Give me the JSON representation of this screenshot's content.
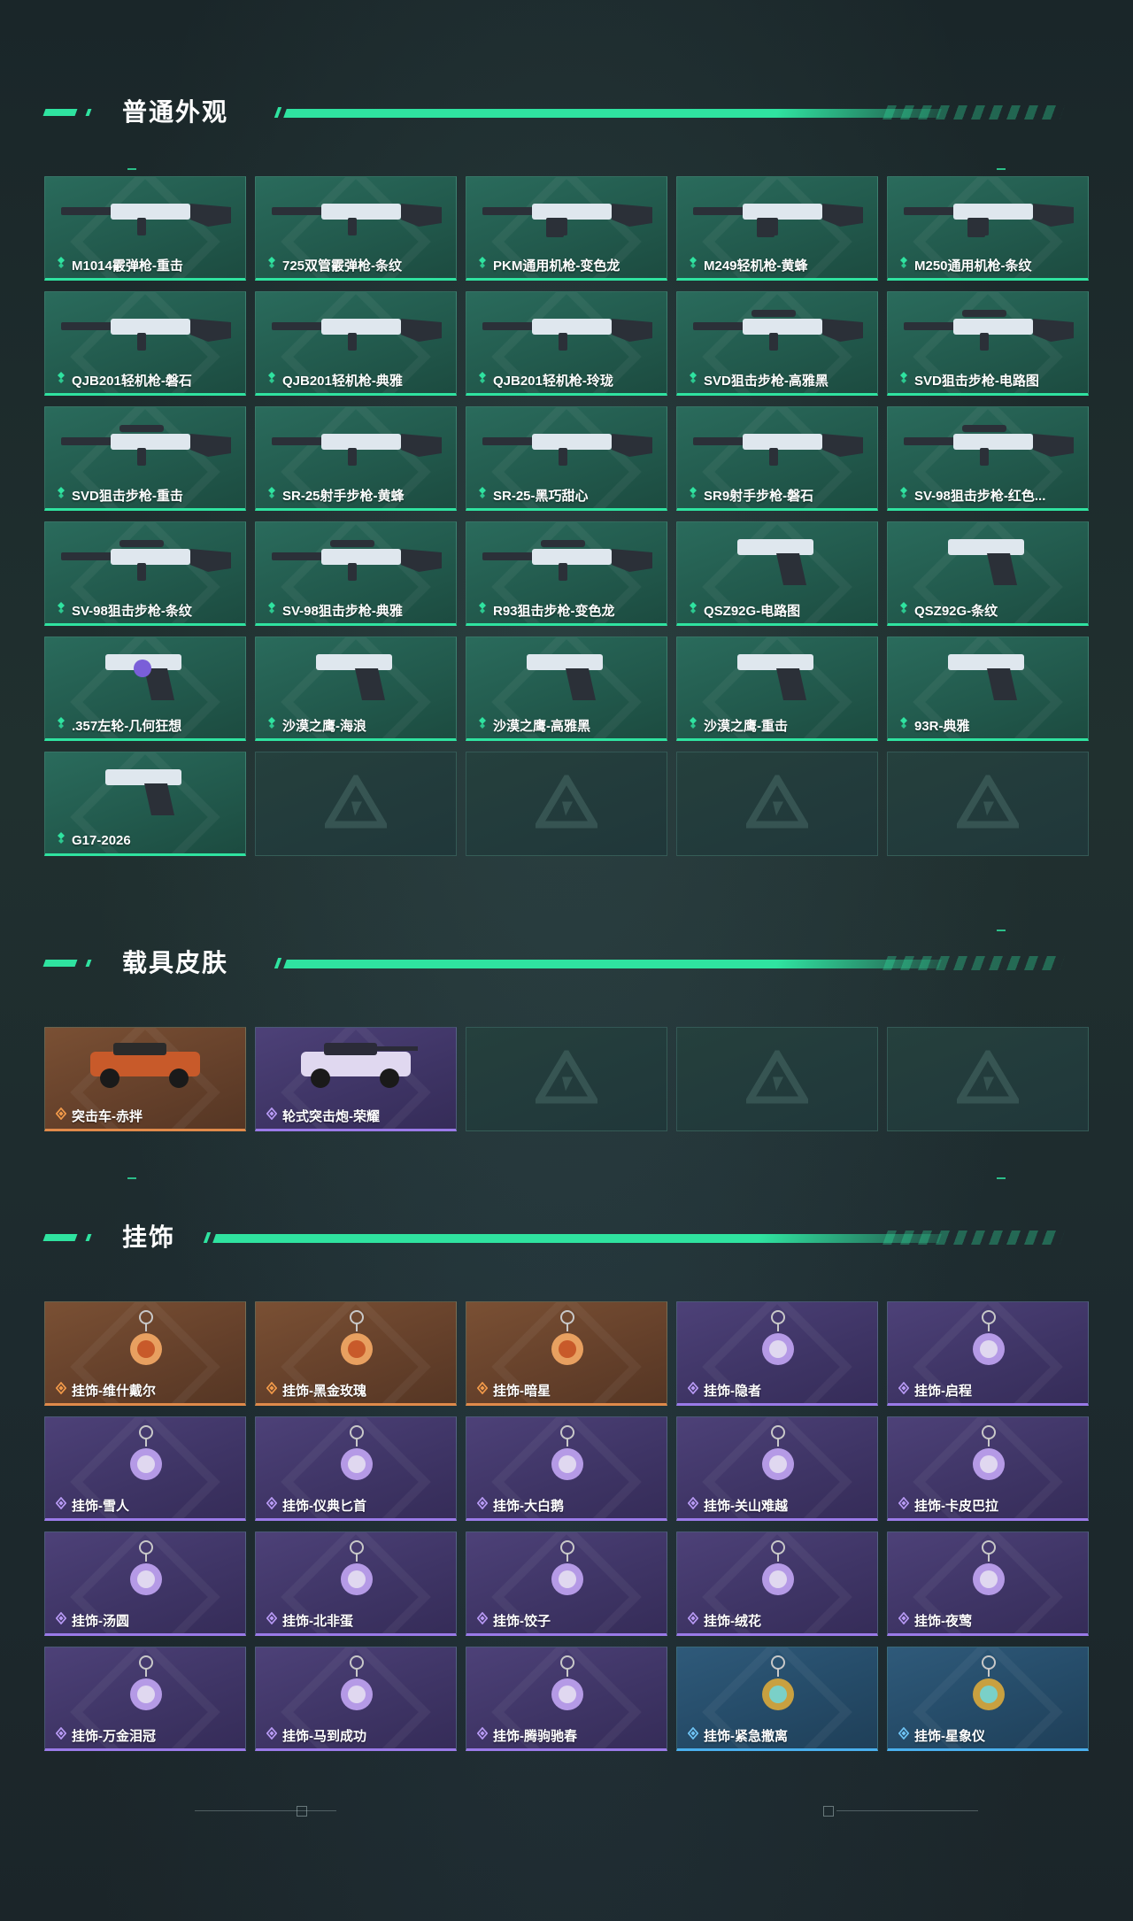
{
  "sections": {
    "normal": {
      "title": "普通外观"
    },
    "vehicle": {
      "title": "载具皮肤"
    },
    "charm": {
      "title": "挂饰"
    }
  },
  "colors": {
    "accent": "#2fe3a0",
    "green": "#2a6b5c",
    "orange": "#7a5034",
    "purple": "#4d4178",
    "blue": "#2f5a7a"
  },
  "weapons": [
    {
      "label": "M1014霰弹枪-重击",
      "rarity": "green",
      "icon": "shotgun-icon"
    },
    {
      "label": "725双管霰弹枪-条纹",
      "rarity": "green",
      "icon": "shotgun-icon"
    },
    {
      "label": "PKM通用机枪-变色龙",
      "rarity": "green",
      "icon": "machine-gun-icon"
    },
    {
      "label": "M249轻机枪-黄蜂",
      "rarity": "green",
      "icon": "machine-gun-icon"
    },
    {
      "label": "M250通用机枪-条纹",
      "rarity": "green",
      "icon": "machine-gun-icon"
    },
    {
      "label": "QJB201轻机枪-磐石",
      "rarity": "green",
      "icon": "rifle-icon"
    },
    {
      "label": "QJB201轻机枪-典雅",
      "rarity": "green",
      "icon": "rifle-icon"
    },
    {
      "label": "QJB201轻机枪-玲珑",
      "rarity": "green",
      "icon": "rifle-icon"
    },
    {
      "label": "SVD狙击步枪-高雅黑",
      "rarity": "green",
      "icon": "sniper-icon"
    },
    {
      "label": "SVD狙击步枪-电路图",
      "rarity": "green",
      "icon": "sniper-icon"
    },
    {
      "label": "SVD狙击步枪-重击",
      "rarity": "green",
      "icon": "sniper-icon"
    },
    {
      "label": "SR-25射手步枪-黄蜂",
      "rarity": "green",
      "icon": "rifle-icon"
    },
    {
      "label": "SR-25-黑巧甜心",
      "rarity": "green",
      "icon": "rifle-icon"
    },
    {
      "label": "SR9射手步枪-磐石",
      "rarity": "green",
      "icon": "rifle-icon"
    },
    {
      "label": "SV-98狙击步枪-红色...",
      "rarity": "green",
      "icon": "sniper-icon"
    },
    {
      "label": "SV-98狙击步枪-条纹",
      "rarity": "green",
      "icon": "sniper-icon"
    },
    {
      "label": "SV-98狙击步枪-典雅",
      "rarity": "green",
      "icon": "sniper-icon"
    },
    {
      "label": "R93狙击步枪-变色龙",
      "rarity": "green",
      "icon": "sniper-icon"
    },
    {
      "label": "QSZ92G-电路图",
      "rarity": "green",
      "icon": "pistol-icon"
    },
    {
      "label": "QSZ92G-条纹",
      "rarity": "green",
      "icon": "pistol-icon"
    },
    {
      "label": ".357左轮-几何狂想",
      "rarity": "green",
      "icon": "revolver-icon"
    },
    {
      "label": "沙漠之鹰-海浪",
      "rarity": "green",
      "icon": "pistol-icon"
    },
    {
      "label": "沙漠之鹰-高雅黑",
      "rarity": "green",
      "icon": "pistol-icon"
    },
    {
      "label": "沙漠之鹰-重击",
      "rarity": "green",
      "icon": "pistol-icon"
    },
    {
      "label": "93R-典雅",
      "rarity": "green",
      "icon": "pistol-icon"
    },
    {
      "label": "G17-2026",
      "rarity": "green",
      "icon": "pistol-icon"
    }
  ],
  "weapon_empty_slots": 4,
  "vehicles": [
    {
      "label": "突击车-赤拌",
      "rarity": "orange",
      "icon": "assault-vehicle-icon"
    },
    {
      "label": "轮式突击炮-荣耀",
      "rarity": "purple",
      "icon": "wheeled-gun-icon"
    }
  ],
  "vehicle_empty_slots": 3,
  "charms": [
    {
      "label": "挂饰-维什戴尔",
      "rarity": "orange",
      "icon": "charm-icon"
    },
    {
      "label": "挂饰-黑金玫瑰",
      "rarity": "orange",
      "icon": "charm-icon"
    },
    {
      "label": "挂饰-暗星",
      "rarity": "orange",
      "icon": "charm-icon"
    },
    {
      "label": "挂饰-隐者",
      "rarity": "purple",
      "icon": "charm-icon"
    },
    {
      "label": "挂饰-启程",
      "rarity": "purple",
      "icon": "charm-icon"
    },
    {
      "label": "挂饰-雪人",
      "rarity": "purple",
      "icon": "charm-icon"
    },
    {
      "label": "挂饰-仪典匕首",
      "rarity": "purple",
      "icon": "charm-icon"
    },
    {
      "label": "挂饰-大白鹅",
      "rarity": "purple",
      "icon": "charm-icon"
    },
    {
      "label": "挂饰-关山难越",
      "rarity": "purple",
      "icon": "charm-icon"
    },
    {
      "label": "挂饰-卡皮巴拉",
      "rarity": "purple",
      "icon": "charm-icon"
    },
    {
      "label": "挂饰-汤圆",
      "rarity": "purple",
      "icon": "charm-icon"
    },
    {
      "label": "挂饰-北非蛋",
      "rarity": "purple",
      "icon": "charm-icon"
    },
    {
      "label": "挂饰-饺子",
      "rarity": "purple",
      "icon": "charm-icon"
    },
    {
      "label": "挂饰-绒花",
      "rarity": "purple",
      "icon": "charm-icon"
    },
    {
      "label": "挂饰-夜莺",
      "rarity": "purple",
      "icon": "charm-icon"
    },
    {
      "label": "挂饰-万金泪冠",
      "rarity": "purple",
      "icon": "charm-icon"
    },
    {
      "label": "挂饰-马到成功",
      "rarity": "purple",
      "icon": "charm-icon"
    },
    {
      "label": "挂饰-腾驹驰春",
      "rarity": "purple",
      "icon": "charm-icon"
    },
    {
      "label": "挂饰-紧急撤离",
      "rarity": "blue",
      "icon": "charm-icon"
    },
    {
      "label": "挂饰-星象仪",
      "rarity": "blue",
      "icon": "charm-icon"
    }
  ]
}
